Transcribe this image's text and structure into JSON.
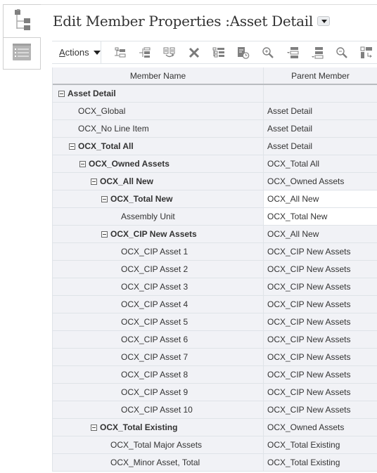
{
  "page": {
    "title": "Edit Member Properties :Asset Detail"
  },
  "side_tabs": [
    {
      "name": "hierarchy-tab",
      "icon": "tree-hierarchy-icon",
      "active": true
    },
    {
      "name": "list-tab",
      "icon": "list-view-icon",
      "active": false
    }
  ],
  "toolbar": {
    "actions_label": "Actions",
    "actions_accesskey": "A",
    "buttons": [
      {
        "name": "add-child",
        "icon": "add-child-icon"
      },
      {
        "name": "add-sibling",
        "icon": "add-sibling-icon"
      },
      {
        "name": "move",
        "icon": "move-icon"
      },
      {
        "name": "delete",
        "icon": "delete-x-icon"
      },
      {
        "name": "view-hierarchy",
        "icon": "hierarchy-view-icon"
      },
      {
        "name": "history",
        "icon": "history-icon"
      },
      {
        "name": "zoom-in",
        "icon": "zoom-in-icon"
      },
      {
        "name": "collapse-row",
        "icon": "collapse-row-icon"
      },
      {
        "name": "expand-row",
        "icon": "expand-row-icon"
      },
      {
        "name": "zoom-out",
        "icon": "zoom-out-icon"
      },
      {
        "name": "pivot",
        "icon": "pivot-icon"
      }
    ]
  },
  "grid": {
    "columns": [
      "Member Name",
      "Parent Member"
    ],
    "rows": [
      {
        "name": "Asset Detail",
        "parent": "",
        "level": 0,
        "expandable": true,
        "bold": true
      },
      {
        "name": "OCX_Global",
        "parent": "Asset Detail",
        "level": 1,
        "expandable": false,
        "bold": false
      },
      {
        "name": "OCX_No Line Item",
        "parent": "Asset Detail",
        "level": 1,
        "expandable": false,
        "bold": false
      },
      {
        "name": "OCX_Total All",
        "parent": "Asset Detail",
        "level": 1,
        "expandable": true,
        "bold": true
      },
      {
        "name": "OCX_Owned Assets",
        "parent": "OCX_Total All",
        "level": 2,
        "expandable": true,
        "bold": true
      },
      {
        "name": "OCX_All New",
        "parent": "OCX_Owned Assets",
        "level": 3,
        "expandable": true,
        "bold": true
      },
      {
        "name": "OCX_Total New",
        "parent": "OCX_All New",
        "level": 4,
        "expandable": true,
        "bold": true,
        "parent_editable": true
      },
      {
        "name": "Assembly Unit",
        "parent": "OCX_Total New",
        "level": 5,
        "expandable": false,
        "bold": false,
        "parent_editable": true
      },
      {
        "name": "OCX_CIP New Assets",
        "parent": "OCX_All New",
        "level": 4,
        "expandable": true,
        "bold": true
      },
      {
        "name": "OCX_CIP Asset 1",
        "parent": "OCX_CIP New Assets",
        "level": 5,
        "expandable": false,
        "bold": false
      },
      {
        "name": "OCX_CIP Asset 2",
        "parent": "OCX_CIP New Assets",
        "level": 5,
        "expandable": false,
        "bold": false
      },
      {
        "name": "OCX_CIP Asset 3",
        "parent": "OCX_CIP New Assets",
        "level": 5,
        "expandable": false,
        "bold": false
      },
      {
        "name": "OCX_CIP Asset 4",
        "parent": "OCX_CIP New Assets",
        "level": 5,
        "expandable": false,
        "bold": false
      },
      {
        "name": "OCX_CIP Asset 5",
        "parent": "OCX_CIP New Assets",
        "level": 5,
        "expandable": false,
        "bold": false
      },
      {
        "name": "OCX_CIP Asset 6",
        "parent": "OCX_CIP New Assets",
        "level": 5,
        "expandable": false,
        "bold": false
      },
      {
        "name": "OCX_CIP Asset 7",
        "parent": "OCX_CIP New Assets",
        "level": 5,
        "expandable": false,
        "bold": false
      },
      {
        "name": "OCX_CIP Asset 8",
        "parent": "OCX_CIP New Assets",
        "level": 5,
        "expandable": false,
        "bold": false
      },
      {
        "name": "OCX_CIP Asset 9",
        "parent": "OCX_CIP New Assets",
        "level": 5,
        "expandable": false,
        "bold": false
      },
      {
        "name": "OCX_CIP Asset 10",
        "parent": "OCX_CIP New Assets",
        "level": 5,
        "expandable": false,
        "bold": false
      },
      {
        "name": "OCX_Total Existing",
        "parent": "OCX_Owned Assets",
        "level": 3,
        "expandable": true,
        "bold": true
      },
      {
        "name": "OCX_Total Major Assets",
        "parent": "OCX_Total Existing",
        "level": 4,
        "expandable": false,
        "bold": false
      },
      {
        "name": "OCX_Minor Asset, Total",
        "parent": "OCX_Total Existing",
        "level": 4,
        "expandable": false,
        "bold": false
      }
    ]
  },
  "colors": {
    "grid_bg": "#f1f2f6",
    "editable_cell_bg": "#ffffff",
    "border": "#dfe3e8",
    "icon_gray": "#808080"
  }
}
